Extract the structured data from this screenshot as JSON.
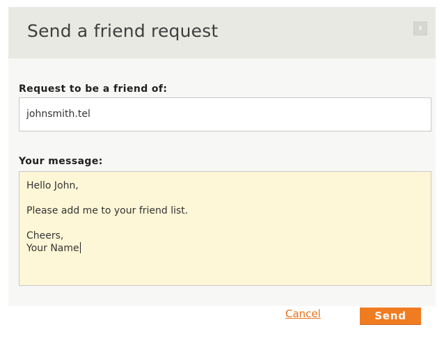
{
  "dialog": {
    "title": "Send a friend request",
    "close_label": "x"
  },
  "form": {
    "friend_label": "Request to be a friend of:",
    "friend_value": "johnsmith.tel",
    "message_label": "Your message:",
    "message_lines": [
      "Hello John,",
      "",
      "Please add me to your friend list.",
      "",
      "Cheers,",
      "Your Name"
    ]
  },
  "actions": {
    "cancel_label": "Cancel",
    "send_label": "Send"
  },
  "colors": {
    "header_bg": "#e9e9e4",
    "body_bg": "#f7f7f5",
    "message_bg": "#fef7d7",
    "accent": "#f07c22",
    "link": "#e8701a"
  }
}
